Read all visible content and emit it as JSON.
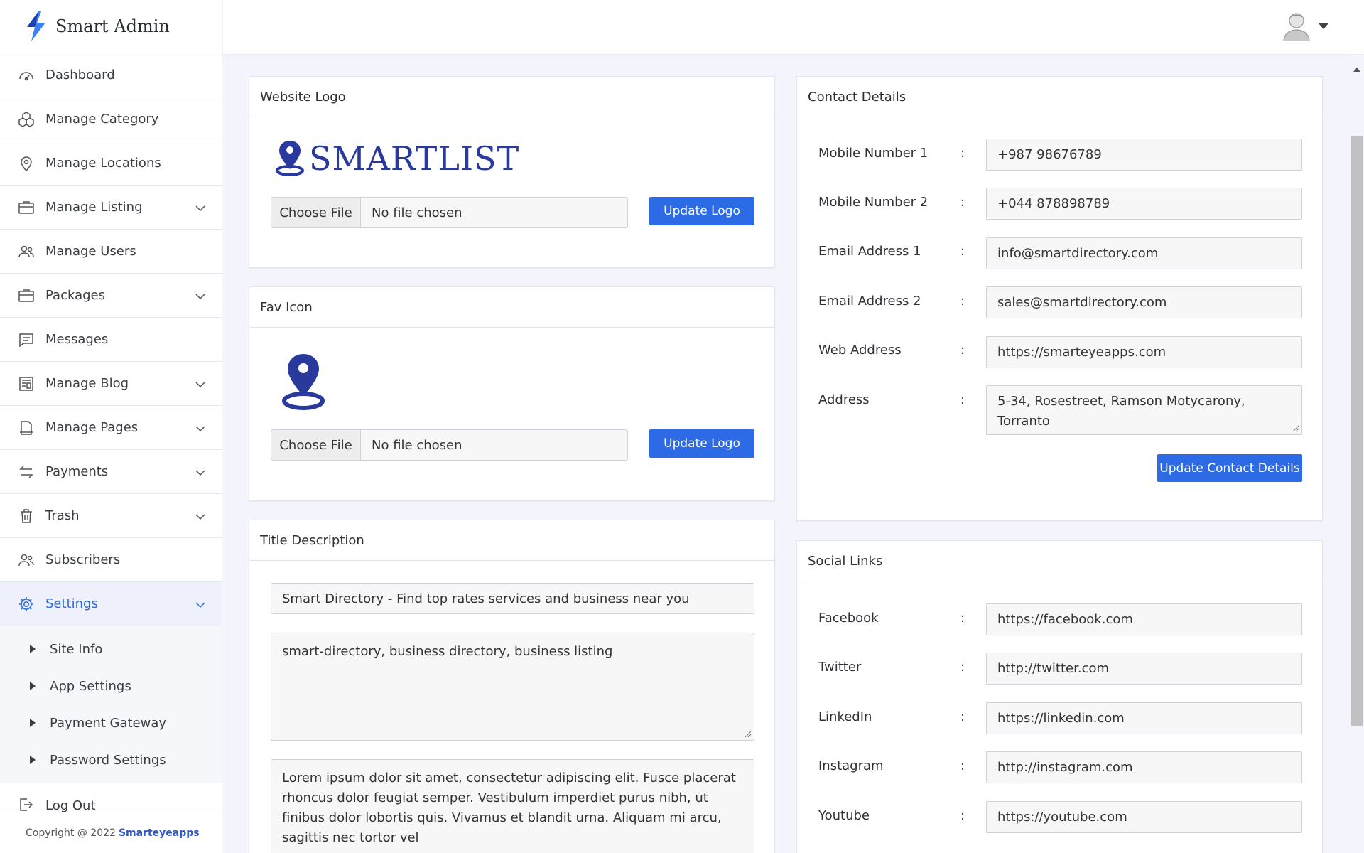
{
  "brand": {
    "name": "Smart Admin"
  },
  "sidebar": {
    "items": [
      {
        "label": "Dashboard"
      },
      {
        "label": "Manage Category"
      },
      {
        "label": "Manage Locations"
      },
      {
        "label": "Manage Listing"
      },
      {
        "label": "Manage Users"
      },
      {
        "label": "Packages"
      },
      {
        "label": "Messages"
      },
      {
        "label": "Manage Blog"
      },
      {
        "label": "Manage Pages"
      },
      {
        "label": "Payments"
      },
      {
        "label": "Trash"
      },
      {
        "label": "Subscribers"
      },
      {
        "label": "Settings"
      }
    ],
    "submenu": [
      {
        "label": "Site Info"
      },
      {
        "label": "App Settings"
      },
      {
        "label": "Payment Gateway"
      },
      {
        "label": "Password Settings"
      }
    ],
    "logout": "Log Out",
    "copyright_prefix": "Copyright @ 2022",
    "copyright_link": "Smarteyeapps"
  },
  "website_logo": {
    "title": "Website Logo",
    "logo_text": "SMARTLIST",
    "choose_label": "Choose File",
    "file_status": "No file chosen",
    "button": "Update Logo"
  },
  "fav_icon": {
    "title": "Fav Icon",
    "choose_label": "Choose File",
    "file_status": "No file chosen",
    "button": "Update Logo"
  },
  "title_description": {
    "title": "Title Description",
    "site_title": "Smart Directory - Find top rates services and business near you",
    "keywords": "smart-directory, business directory, business listing",
    "description": "Lorem ipsum dolor sit amet, consectetur adipiscing elit. Fusce placerat rhoncus dolor feugiat semper. Vestibulum imperdiet purus nibh, ut finibus dolor lobortis quis. Vivamus et blandit urna. Aliquam mi arcu, sagittis nec tortor vel"
  },
  "contact": {
    "title": "Contact Details",
    "fields": [
      {
        "label": "Mobile Number 1",
        "value": "+987 98676789"
      },
      {
        "label": "Mobile Number 2",
        "value": "+044 878898789"
      },
      {
        "label": "Email Address 1",
        "value": "info@smartdirectory.com"
      },
      {
        "label": "Email Address 2",
        "value": "sales@smartdirectory.com"
      },
      {
        "label": "Web Address",
        "value": "https://smarteyeapps.com"
      },
      {
        "label": "Address",
        "value": "5-34, Rosestreet, Ramson Motycarony, Torranto"
      }
    ],
    "colon": ":",
    "button": "Update Contact Details"
  },
  "social": {
    "title": "Social Links",
    "fields": [
      {
        "label": "Facebook",
        "value": "https://facebook.com"
      },
      {
        "label": "Twitter",
        "value": "http://twitter.com"
      },
      {
        "label": "LinkedIn",
        "value": "https://linkedin.com"
      },
      {
        "label": "Instagram",
        "value": "http://instagram.com"
      },
      {
        "label": "Youtube",
        "value": "https://youtube.com"
      }
    ],
    "colon": ":"
  },
  "colors": {
    "accent": "#2d6ae6",
    "brand_blue": "#2a3a9c",
    "active_text": "#2f6be0"
  }
}
